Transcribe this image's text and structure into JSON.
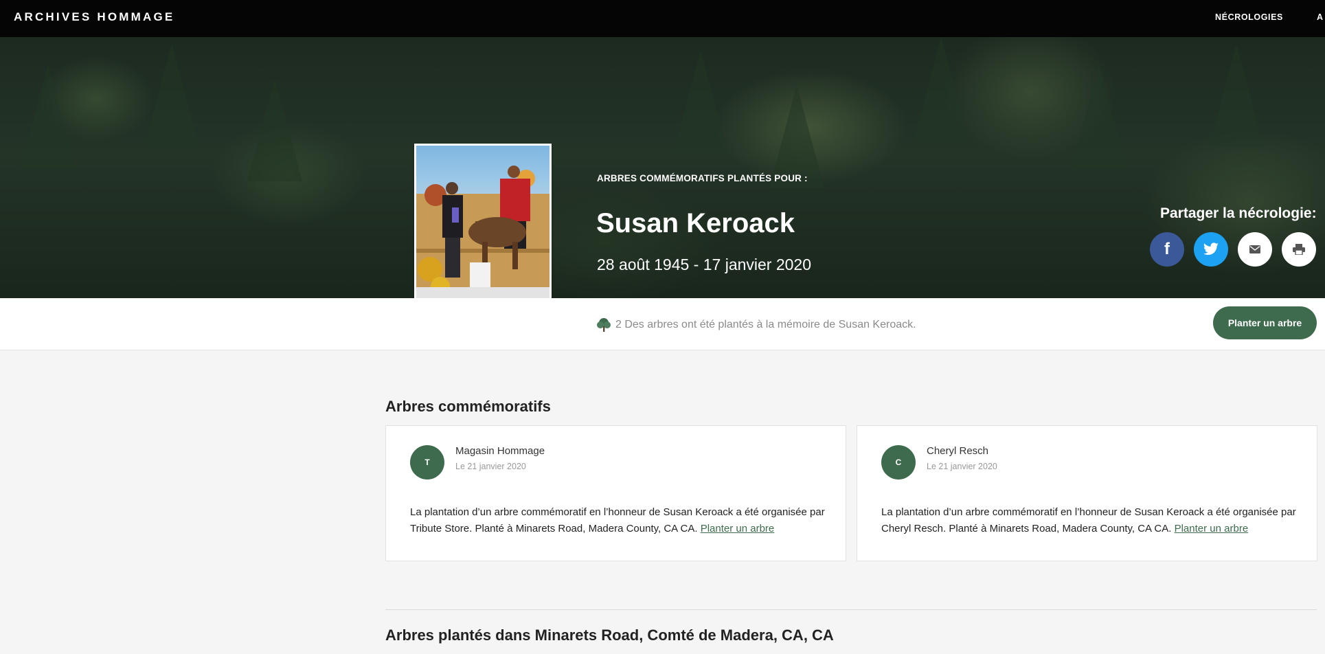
{
  "header": {
    "brand": "ARCHIVES HOMMAGE",
    "nav": [
      "NÉCROLOGIES",
      "A"
    ]
  },
  "hero": {
    "label": "ARBRES COMMÉMORATIFS PLANTÉS POUR :",
    "name": "Susan Keroack",
    "dates": "28 août 1945 - 17 janvier 2020",
    "share_label": "Partager la nécrologie:",
    "share_buttons": [
      {
        "icon": "facebook-icon",
        "glyph": "f",
        "color": "#3b5998"
      },
      {
        "icon": "twitter-icon",
        "color": "#1da1f2"
      },
      {
        "icon": "email-icon",
        "color": "#ffffff"
      },
      {
        "icon": "print-icon",
        "color": "#ffffff"
      }
    ]
  },
  "strip": {
    "text": "2 Des arbres ont été plantés à la mémoire de Susan Keroack.",
    "plant_button": "Planter un arbre"
  },
  "memorial": {
    "title": "Arbres commémoratifs",
    "cards": [
      {
        "initial": "T",
        "name": "Magasin Hommage",
        "date": "Le 21 janvier 2020",
        "text": "La plantation d’un arbre commémoratif en l’honneur de Susan Keroack a été organisée par Tribute Store. Planté à Minarets Road, Madera County, CA CA.",
        "link": "Planter un arbre"
      },
      {
        "initial": "C",
        "name": "Cheryl Resch",
        "date": "Le 21 janvier 2020",
        "text": "La plantation d’un arbre commémoratif en l’honneur de Susan Keroack a été organisée par Cheryl Resch. Planté à Minarets Road, Madera County, CA CA.",
        "link": "Planter un arbre"
      }
    ]
  },
  "location_section": {
    "title": "Arbres plantés dans Minarets Road, Comté de Madera, CA, CA"
  },
  "colors": {
    "accent": "#3e6b4d",
    "topbar": "#050505"
  }
}
